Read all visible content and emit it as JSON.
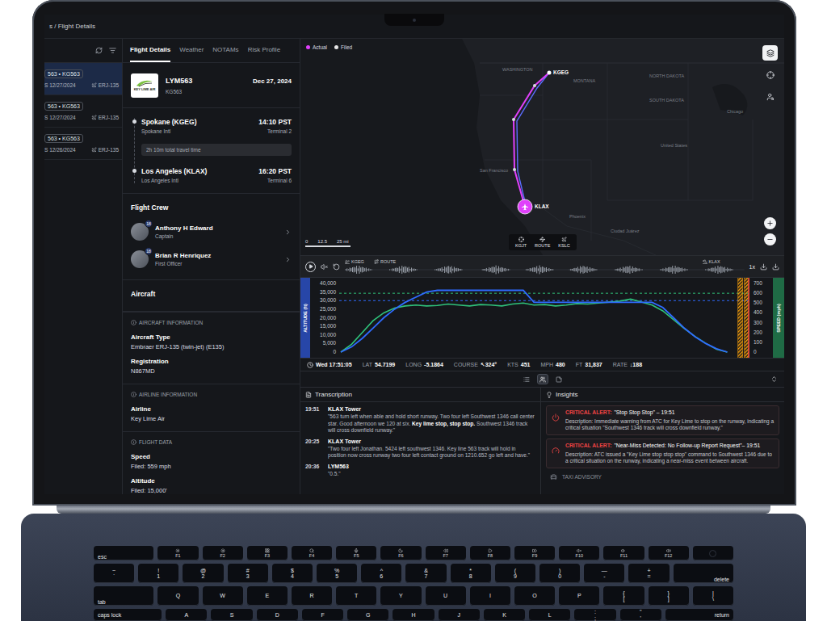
{
  "breadcrumb": "s / Flight Details",
  "flights": [
    {
      "badge": "563 • KG563",
      "date": "S 12/27/2024",
      "aircraft": "ERJ-135",
      "selected": true
    },
    {
      "badge": "563 • KG563",
      "date": "S 12/27/2024",
      "aircraft": "ERJ-135",
      "selected": false
    },
    {
      "badge": "563 • KG563",
      "date": "S 12/26/2024",
      "aircraft": "ERJ-135",
      "selected": false
    }
  ],
  "tabs": [
    {
      "label": "Flight Details",
      "selected": true
    },
    {
      "label": "Weather",
      "selected": false
    },
    {
      "label": "NOTAMs",
      "selected": false
    },
    {
      "label": "Risk Profile",
      "selected": false
    }
  ],
  "flight": {
    "logo_text": "KEY LIME AIR",
    "callsign": "LYM563",
    "date": "Dec 27, 2024",
    "code": "KG563",
    "departure": {
      "city": "Spokane (KGEG)",
      "time": "14:10 PST",
      "airport": "Spokane Intl",
      "terminal": "Terminal 2"
    },
    "duration": "2h 10m total travel time",
    "arrival": {
      "city": "Los Angeles (KLAX)",
      "time": "16:20 PST",
      "airport": "Los Angeles Intl",
      "terminal": "Terminal 6"
    }
  },
  "crew": {
    "title": "Flight Crew",
    "members": [
      {
        "name": "Anthony H Edward",
        "role": "Captain",
        "badge": "18"
      },
      {
        "name": "Brian R Henriquez",
        "role": "First Officer",
        "badge": "18"
      }
    ]
  },
  "aircraft": {
    "title": "Aircraft",
    "sections": [
      {
        "heading": "AIRCRAFT INFORMATION",
        "fields": [
          {
            "label": "Aircraft Type",
            "value": "Embraer ERJ-135 (twin-jet) (E135)"
          },
          {
            "label": "Registration",
            "value": "N867MD"
          }
        ]
      },
      {
        "heading": "AIRLINE INFORMATION",
        "fields": [
          {
            "label": "Airline",
            "value": "Key Lime Air"
          }
        ]
      },
      {
        "heading": "FLIGHT DATA",
        "fields": [
          {
            "label": "Speed",
            "value": "Filed: 559 mph"
          },
          {
            "label": "Altitude",
            "value": "Filed: 15,000'"
          }
        ]
      }
    ]
  },
  "map": {
    "legend": [
      {
        "label": "Actual",
        "color": "#e040fb"
      },
      {
        "label": "Filed",
        "color": "#e6e6e6"
      }
    ],
    "labels": [
      "WASHINGTON",
      "MONTANA",
      "NORTH DAKOTA",
      "SOUTH DAKOTA",
      "Chicago",
      "United States",
      "San Francisco",
      "Phoenix",
      "Ciudad Juárez"
    ],
    "airports": [
      "KGEG",
      "KLAX"
    ],
    "scale": [
      "0",
      "12.5",
      "25 mi"
    ],
    "buttons": [
      {
        "label": "KGJT"
      },
      {
        "label": "ROUTE"
      },
      {
        "label": "KSLC"
      }
    ]
  },
  "timeline": {
    "labels": [
      "KGEG",
      "ROUTE",
      "KLAX"
    ],
    "speed": "1x"
  },
  "chart": {
    "altitude": {
      "title": "ALTITUDE (ft)",
      "ticks": [
        "40,000",
        "35,000",
        "30,000",
        "25,000",
        "20,000",
        "15,000",
        "10,000",
        "5,000",
        "0"
      ],
      "color": "#2f6bff",
      "values": [
        0,
        3000,
        8000,
        14000,
        20000,
        25000,
        29000,
        32000,
        35000,
        36000,
        36000,
        36000,
        36000,
        36000,
        36000,
        36000,
        36000,
        36000,
        29000,
        29000,
        29000,
        29000,
        29000,
        29000,
        29000,
        29000,
        29000,
        29000,
        29000,
        29000,
        26000,
        20000,
        14000,
        9000,
        5000,
        2000,
        0
      ]
    },
    "speed": {
      "title": "SPEED (mph)",
      "ticks": [
        "700",
        "600",
        "500",
        "400",
        "300",
        "200",
        "100",
        "0"
      ],
      "color": "#2fc27a",
      "values": [
        0,
        80,
        200,
        320,
        400,
        450,
        470,
        480,
        470,
        475,
        490,
        480,
        470,
        485,
        480,
        470,
        490,
        500,
        480,
        485,
        470,
        480,
        495,
        490,
        500,
        510,
        520,
        540,
        510,
        480,
        420,
        330,
        240,
        160,
        90,
        30,
        0
      ]
    },
    "guides": [
      {
        "series": "speed",
        "value": 600
      },
      {
        "series": "altitude",
        "value": 30000
      }
    ],
    "events": [
      {
        "kind": "hatch",
        "at": 37
      },
      {
        "kind": "hatch",
        "at": 37.6
      },
      {
        "kind": "line",
        "at": 38
      }
    ]
  },
  "status": {
    "time": "Wed 17:51:05",
    "readings": [
      {
        "label": "LAT",
        "value": "54.7199"
      },
      {
        "label": "LONG",
        "value": "-5.1864"
      },
      {
        "label": "COURSE",
        "value": "↖324°"
      },
      {
        "label": "KTS",
        "value": "451"
      },
      {
        "label": "MPH",
        "value": "480"
      },
      {
        "label": "FT",
        "value": "31,837"
      },
      {
        "label": "RATE",
        "value": "↓188"
      }
    ]
  },
  "views": [
    {
      "selected": false
    },
    {
      "selected": true
    },
    {
      "selected": false
    }
  ],
  "transcription": {
    "title": "Transcription",
    "entries": [
      {
        "time": "19:51",
        "speaker": "KLAX Tower",
        "segments": [
          {
            "text": "\"563 turn left when able and hold short runway. Two four left Southwest 1346 call center star. Good afternoon we 120 at six. ",
            "bold": false
          },
          {
            "text": "Key lime stop, stop stop.",
            "bold": true
          },
          {
            "text": " Southwest 1346 track will cross downfield runway.\"",
            "bold": false
          }
        ]
      },
      {
        "time": "20:25",
        "speaker": "KLAX Tower",
        "segments": [
          {
            "text": "\"Two four left Jonathan. 5424 left southwest 1346. Key line 563 track will hold in position now cross runway two four left contact ground on 1210.652 go left and have.\"",
            "bold": false
          }
        ]
      },
      {
        "time": "20:36",
        "speaker": "LYM563",
        "segments": [
          {
            "text": "\"0.5.\"",
            "bold": false
          }
        ]
      }
    ]
  },
  "insights": {
    "title": "Insights",
    "alerts": [
      {
        "kind": "critical",
        "tag": "CRITICAL ALERT:",
        "title": "\"Stop Stop Stop\" – 19:51",
        "description": "Description: Immediate warning from ATC for Key Lime to stop on the runway, indicating a critical situation \"Southwest 1346 track will cross downfield runway.\""
      },
      {
        "kind": "critical",
        "tag": "CRITICAL ALERT:",
        "title": "\"Near-Miss Detected: No Follow-up Report Request\"– 19:51",
        "description": "Description: ATC issued a \"Key Lime stop stop stop\" command to Southwest 1346 due to a critical situation on the runway, indicating a near-miss event between aircraft."
      },
      {
        "kind": "advisory",
        "tag": "TAXI ADVISORY"
      }
    ]
  },
  "keyboard": {
    "rows": [
      {
        "keys": [
          {
            "kind": "esc",
            "label": "esc"
          },
          {
            "kind": "fn",
            "label": "F1"
          },
          {
            "kind": "fn",
            "label": "F2"
          },
          {
            "kind": "fn",
            "label": "F3"
          },
          {
            "kind": "fn",
            "label": "F4"
          },
          {
            "kind": "fn",
            "label": "F5"
          },
          {
            "kind": "fn",
            "label": "F6"
          },
          {
            "kind": "fn",
            "label": "F7"
          },
          {
            "kind": "fn",
            "label": "F8"
          },
          {
            "kind": "fn",
            "label": "F9"
          },
          {
            "kind": "fn",
            "label": "F10"
          },
          {
            "kind": "fn",
            "label": "F11"
          },
          {
            "kind": "fn",
            "label": "F12"
          },
          {
            "kind": "power"
          }
        ]
      },
      {
        "keys": [
          {
            "kind": "pair",
            "top": "~",
            "bottom": "`"
          },
          {
            "kind": "pair",
            "top": "!",
            "bottom": "1"
          },
          {
            "kind": "pair",
            "top": "@",
            "bottom": "2"
          },
          {
            "kind": "pair",
            "top": "#",
            "bottom": "3"
          },
          {
            "kind": "pair",
            "top": "$",
            "bottom": "4"
          },
          {
            "kind": "pair",
            "top": "%",
            "bottom": "5"
          },
          {
            "kind": "pair",
            "top": "^",
            "bottom": "6"
          },
          {
            "kind": "pair",
            "top": "&",
            "bottom": "7"
          },
          {
            "kind": "pair",
            "top": "*",
            "bottom": "8"
          },
          {
            "kind": "pair",
            "top": "(",
            "bottom": "9"
          },
          {
            "kind": "pair",
            "top": ")",
            "bottom": "0"
          },
          {
            "kind": "pair",
            "top": "—",
            "bottom": "-"
          },
          {
            "kind": "pair",
            "top": "+",
            "bottom": "="
          },
          {
            "kind": "wide",
            "label": "delete"
          }
        ]
      },
      {
        "keys": [
          {
            "kind": "wide",
            "label": "tab"
          },
          {
            "kind": "letter",
            "label": "Q"
          },
          {
            "kind": "letter",
            "label": "W"
          },
          {
            "kind": "letter",
            "label": "E"
          },
          {
            "kind": "letter",
            "label": "R"
          },
          {
            "kind": "letter",
            "label": "T"
          },
          {
            "kind": "letter",
            "label": "Y"
          },
          {
            "kind": "letter",
            "label": "U"
          },
          {
            "kind": "letter",
            "label": "I"
          },
          {
            "kind": "letter",
            "label": "O"
          },
          {
            "kind": "letter",
            "label": "P"
          },
          {
            "kind": "pair",
            "top": "{",
            "bottom": "["
          },
          {
            "kind": "pair",
            "top": "}",
            "bottom": "]"
          },
          {
            "kind": "pair",
            "top": "|",
            "bottom": "\\"
          }
        ]
      },
      {
        "keys": [
          {
            "kind": "wide",
            "label": "caps lock"
          },
          {
            "kind": "letter",
            "label": "A"
          },
          {
            "kind": "letter",
            "label": "S"
          },
          {
            "kind": "letter",
            "label": "D"
          },
          {
            "kind": "letter",
            "label": "F"
          },
          {
            "kind": "letter",
            "label": "G"
          },
          {
            "kind": "letter",
            "label": "H"
          },
          {
            "kind": "letter",
            "label": "J"
          },
          {
            "kind": "letter",
            "label": "K"
          },
          {
            "kind": "letter",
            "label": "L"
          },
          {
            "kind": "pair",
            "top": ":",
            "bottom": ";"
          },
          {
            "kind": "pair",
            "top": "\"",
            "bottom": "'"
          },
          {
            "kind": "wide",
            "label": "return"
          }
        ]
      }
    ]
  }
}
